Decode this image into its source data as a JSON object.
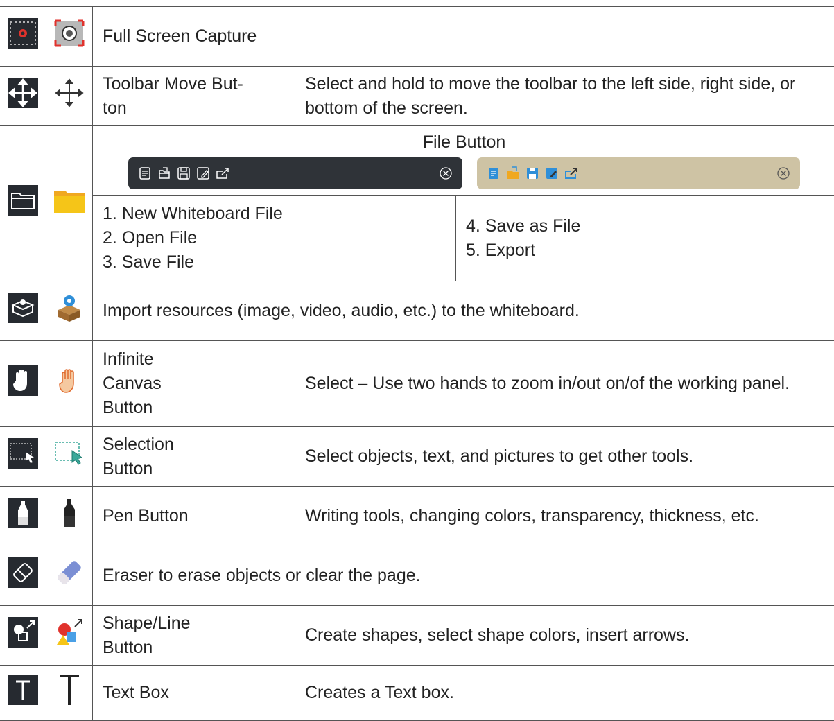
{
  "rows": {
    "full_screen": {
      "desc": "Full Screen Capture"
    },
    "toolbar_move": {
      "name": "Toolbar Move But-\nton",
      "desc": "Select and hold to move the toolbar to the left side, right side, or bottom of the screen."
    },
    "file": {
      "header": "File Button",
      "list_left": [
        "1. New Whiteboard File",
        "2. Open File",
        "3. Save File"
      ],
      "list_right": [
        "4. Save as File",
        "5. Export"
      ]
    },
    "import": {
      "desc": "Import resources (image, video, audio, etc.) to the whiteboard."
    },
    "infinite_canvas": {
      "name": "Infinite\nCanvas\nButton",
      "desc": "Select – Use two hands to zoom in/out on/of the working panel."
    },
    "selection": {
      "name": "Selection\nButton",
      "desc": "Select objects, text, and pictures to get other tools."
    },
    "pen": {
      "name": "Pen Button",
      "desc": "Writing tools, changing colors, transparency, thickness, etc."
    },
    "eraser": {
      "desc": "Eraser to erase objects or clear the page."
    },
    "shape": {
      "name": "Shape/Line\nButton",
      "desc": "Create shapes, select shape colors, insert arrows."
    },
    "text": {
      "name": "Text Box",
      "desc": "Creates a Text box."
    }
  },
  "colors": {
    "dark_icon_bg": "#262a30",
    "toolbar_dark": "#2f3338",
    "toolbar_tan": "#cec3a4",
    "folder": "#f5c518",
    "accent_blue": "#2f8fd8",
    "accent_red": "#e0322c"
  }
}
